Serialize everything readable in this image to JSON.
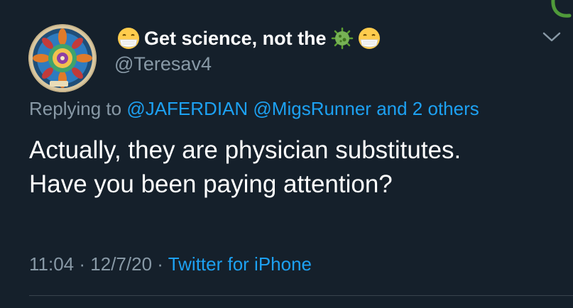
{
  "tweet": {
    "author": {
      "display_name": "Get science, not the",
      "handle": "@Teresav4",
      "avatar_icon": "mandala-avatar-icon",
      "name_emojis": [
        "face-with-medical-mask-icon",
        "microbe-icon",
        "face-with-medical-mask-icon"
      ]
    },
    "reply": {
      "prefix": "Replying to",
      "mentions": [
        "@JAFERDIAN",
        "@MigsRunner"
      ],
      "others": "and 2 others"
    },
    "text_lines": [
      "Actually, they are physician substitutes.",
      "Have you been paying attention?"
    ],
    "meta": {
      "time": "11:04",
      "separator": "·",
      "date": "12/7/20",
      "source": "Twitter for iPhone"
    }
  },
  "colors": {
    "background": "#15202b",
    "primary_text": "#ffffff",
    "secondary_text": "#8899a6",
    "accent": "#1da1f2",
    "divider": "#38444d"
  }
}
